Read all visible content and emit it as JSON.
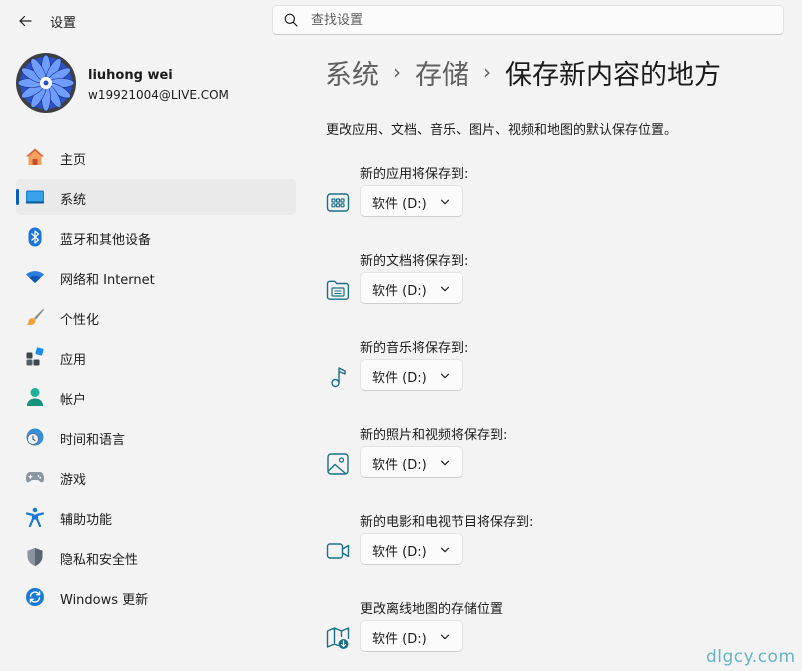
{
  "window": {
    "title": "设置"
  },
  "search": {
    "placeholder": "查找设置",
    "value": ""
  },
  "profile": {
    "name": "liuhong wei",
    "email": "w19921004@LIVE.COM"
  },
  "sidebar": {
    "items": [
      {
        "label": "主页",
        "icon": "home-icon",
        "active": false
      },
      {
        "label": "系统",
        "icon": "system-icon",
        "active": true
      },
      {
        "label": "蓝牙和其他设备",
        "icon": "bluetooth-icon",
        "active": false
      },
      {
        "label": "网络和 Internet",
        "icon": "wifi-icon",
        "active": false
      },
      {
        "label": "个性化",
        "icon": "brush-icon",
        "active": false
      },
      {
        "label": "应用",
        "icon": "apps-icon",
        "active": false
      },
      {
        "label": "帐户",
        "icon": "account-icon",
        "active": false
      },
      {
        "label": "时间和语言",
        "icon": "time-language-icon",
        "active": false
      },
      {
        "label": "游戏",
        "icon": "gamepad-icon",
        "active": false
      },
      {
        "label": "辅助功能",
        "icon": "accessibility-icon",
        "active": false
      },
      {
        "label": "隐私和安全性",
        "icon": "shield-icon",
        "active": false
      },
      {
        "label": "Windows 更新",
        "icon": "update-icon",
        "active": false
      }
    ]
  },
  "breadcrumb": {
    "items": [
      "系统",
      "存储"
    ],
    "current": "保存新内容的地方",
    "separator": "›"
  },
  "main": {
    "description": "更改应用、文档、音乐、图片、视频和地图的默认保存位置。",
    "settings": [
      {
        "label": "新的应用将保存到:",
        "value": "软件 (D:)",
        "icon": "app-icon"
      },
      {
        "label": "新的文档将保存到:",
        "value": "软件 (D:)",
        "icon": "documents-icon"
      },
      {
        "label": "新的音乐将保存到:",
        "value": "软件 (D:)",
        "icon": "music-icon"
      },
      {
        "label": "新的照片和视频将保存到:",
        "value": "软件 (D:)",
        "icon": "photo-icon"
      },
      {
        "label": "新的电影和电视节目将保存到:",
        "value": "软件 (D:)",
        "icon": "video-icon"
      },
      {
        "label": "更改离线地图的存储位置",
        "value": "软件 (D:)",
        "icon": "map-icon"
      }
    ]
  },
  "watermark": "dlgcy.com",
  "colors": {
    "accent": "#005fb8",
    "icon_teal": "#1b6f86",
    "background": "#f3f3f3"
  }
}
